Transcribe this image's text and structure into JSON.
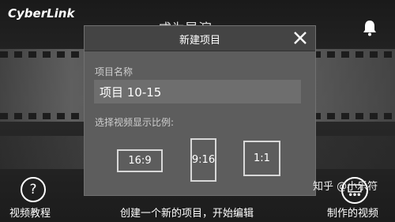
{
  "app": {
    "logo_text": "CyberLink",
    "background_title": "成为导演"
  },
  "dialog": {
    "title": "新建项目",
    "name_label": "项目名称",
    "name_value": "项目 10-15",
    "ratio_label": "选择视频显示比例:",
    "ratios": [
      {
        "label": "16:9"
      },
      {
        "label": "9:16"
      },
      {
        "label": "1:1"
      }
    ]
  },
  "toolbar": {
    "tutorial_label": "视频教程",
    "tutorial_icon_glyph": "?",
    "create_hint": "创建一个新的项目，开始编辑",
    "my_videos_label": "制作的视频"
  },
  "watermark": {
    "text": "知乎 @小乐符"
  },
  "icons": {
    "bell": "bell-icon",
    "close": "close-icon",
    "help": "question-icon",
    "videos": "theater-icon"
  }
}
